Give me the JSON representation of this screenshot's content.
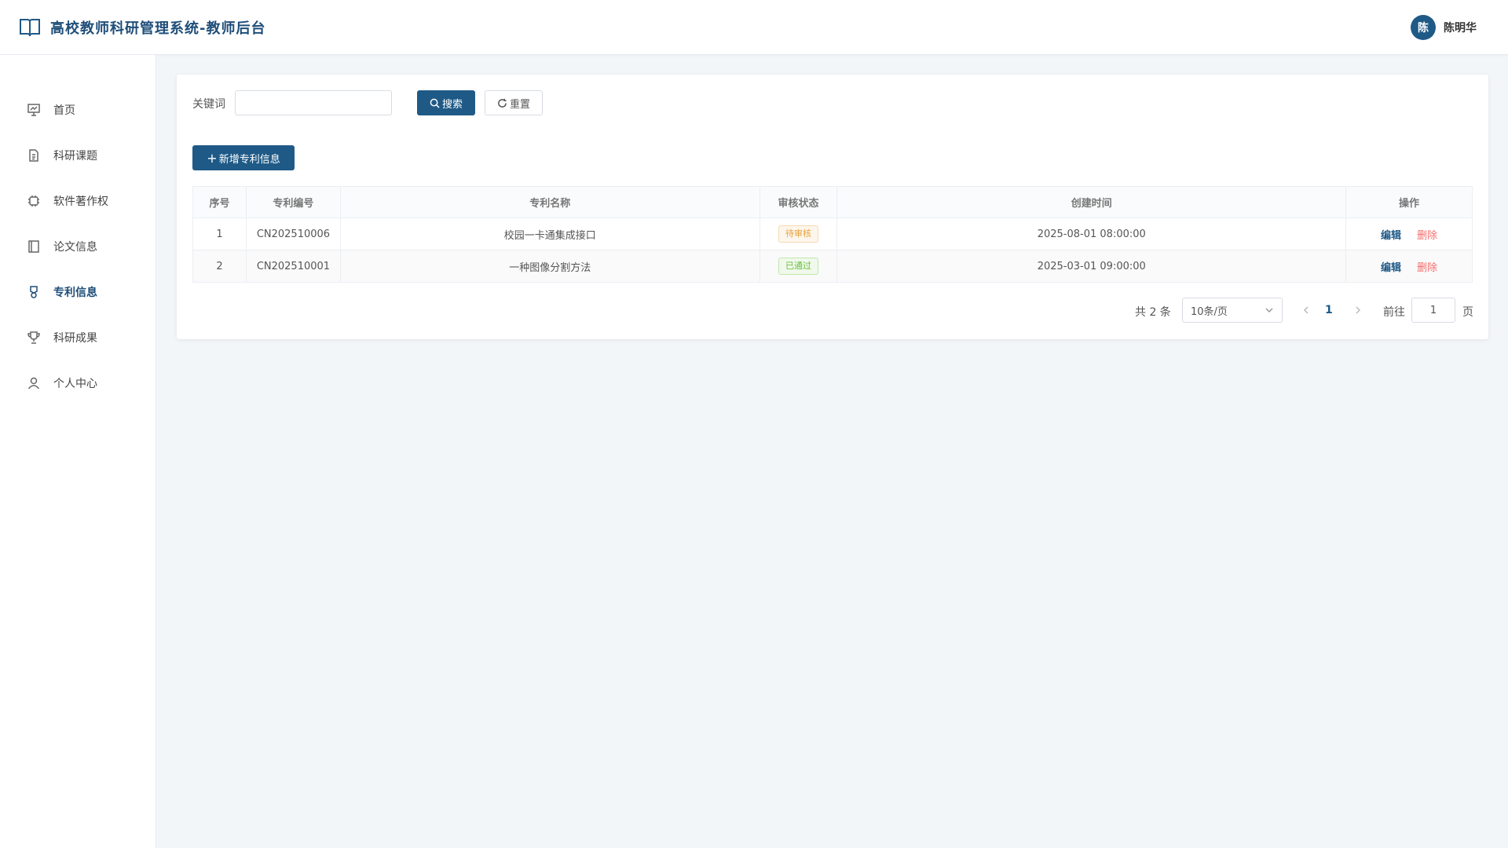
{
  "header": {
    "title": "高校教师科研管理系统-教师后台",
    "user": {
      "avatar_text": "陈",
      "name": "陈明华"
    }
  },
  "sidebar": {
    "items": [
      {
        "label": "首页",
        "icon": "chart-board-icon",
        "active": false
      },
      {
        "label": "科研课题",
        "icon": "document-icon",
        "active": false
      },
      {
        "label": "软件著作权",
        "icon": "cpu-icon",
        "active": false
      },
      {
        "label": "论文信息",
        "icon": "notebook-icon",
        "active": false
      },
      {
        "label": "专利信息",
        "icon": "medal-icon",
        "active": true
      },
      {
        "label": "科研成果",
        "icon": "trophy-icon",
        "active": false
      },
      {
        "label": "个人中心",
        "icon": "user-icon",
        "active": false
      }
    ]
  },
  "search": {
    "keyword_label": "关键词",
    "keyword_value": "",
    "keyword_placeholder": "",
    "search_label": "搜索",
    "reset_label": "重置"
  },
  "toolbar": {
    "add_label": "新增专利信息"
  },
  "table": {
    "columns": [
      "序号",
      "专利编号",
      "专利名称",
      "审核状态",
      "创建时间",
      "操作"
    ],
    "rows": [
      {
        "index": "1",
        "code": "CN202510006",
        "name": "校园一卡通集成接口",
        "status": "待审核",
        "status_type": "pending",
        "created": "2025-08-01 08:00:00"
      },
      {
        "index": "2",
        "code": "CN202510001",
        "name": "一种图像分割方法",
        "status": "已通过",
        "status_type": "passed",
        "created": "2025-03-01 09:00:00"
      }
    ],
    "edit_label": "编辑",
    "delete_label": "删除"
  },
  "pagination": {
    "total_text": "共 2 条",
    "page_size": "10条/页",
    "current_page": "1",
    "goto_label": "前往",
    "goto_value": "1",
    "goto_suffix": "页"
  },
  "colors": {
    "primary": "#1f5a87",
    "pending": "#e6a23c",
    "passed": "#67c23a",
    "danger": "#f56c6c"
  }
}
